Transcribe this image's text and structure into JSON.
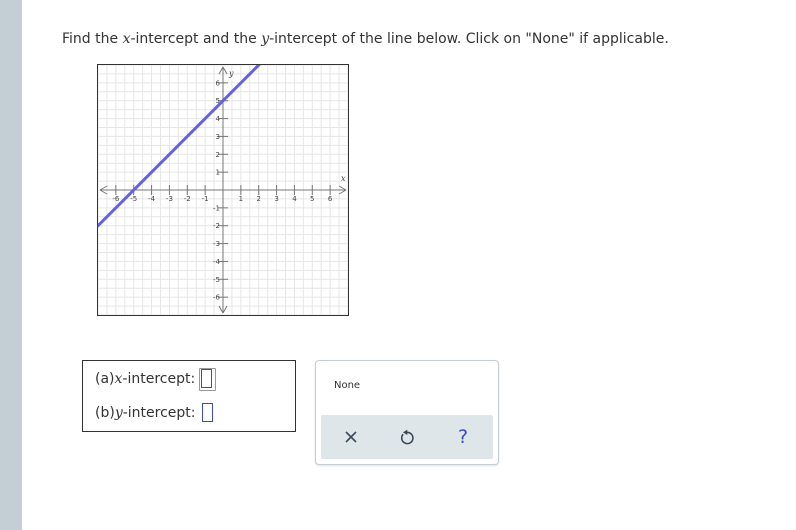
{
  "question": {
    "part1": "Find the ",
    "var_x": "x",
    "part2": "-intercept and the ",
    "var_y": "y",
    "part3": "-intercept of the line below. Click on \"None\" if applicable."
  },
  "graph": {
    "x_axis_label": "x",
    "y_axis_label": "y",
    "x_ticks": [
      "-6",
      "-5",
      "-4",
      "-3",
      "-2",
      "-1",
      "1",
      "2",
      "3",
      "4",
      "5",
      "6"
    ],
    "y_ticks": [
      "6",
      "5",
      "4",
      "3",
      "2",
      "1",
      "-1",
      "-2",
      "-3",
      "-4",
      "-5",
      "-6"
    ],
    "range": [
      -7,
      7
    ],
    "line": {
      "from": [
        -7,
        -2
      ],
      "to": [
        4,
        9
      ],
      "color": "#6363e0"
    },
    "grid": true
  },
  "answers": {
    "a_prefix": "(a) ",
    "a_var": "x",
    "a_suffix": "-intercept:",
    "b_prefix": "(b) ",
    "b_var": "y",
    "b_suffix": "-intercept:"
  },
  "keypad": {
    "none_label": "None",
    "clear_icon": "close-icon",
    "undo_icon": "undo-icon",
    "help_label": "?"
  },
  "colors": {
    "accent": "#3b4cc0",
    "sidebar": "#c3ced5",
    "keypad_bar": "#dfe6ea"
  }
}
